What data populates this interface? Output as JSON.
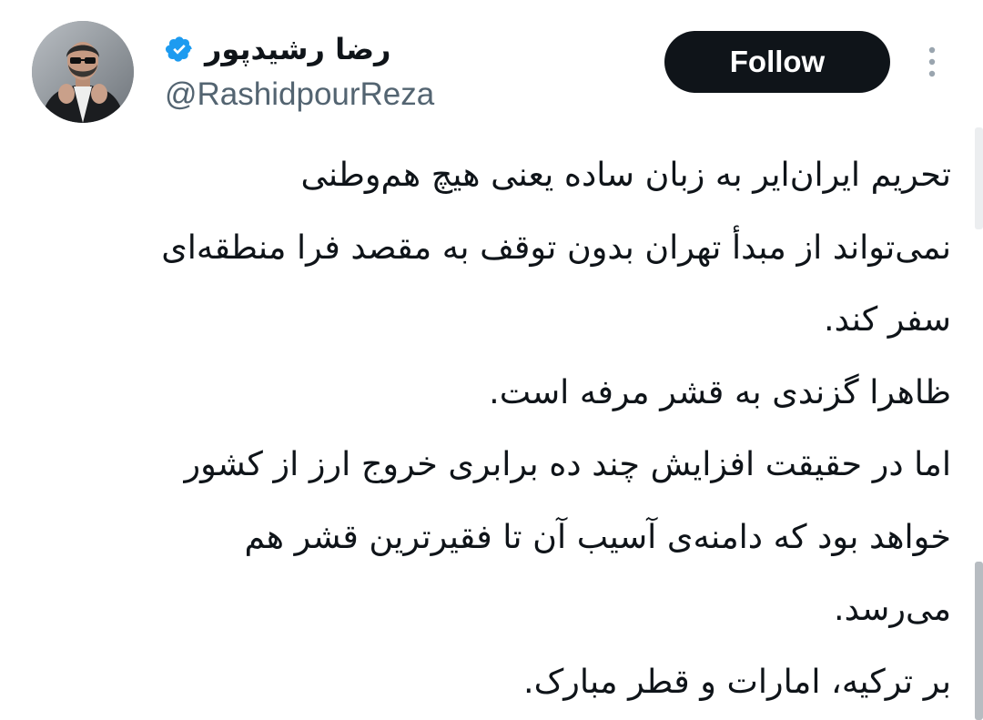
{
  "author": {
    "display_name": "رضا رشیدپور",
    "handle": "@RashidpourReza",
    "verified_color": "#1d9bf0",
    "verified_icon": "verified-badge-icon"
  },
  "actions": {
    "follow_label": "Follow",
    "more_icon": "more-vertical-icon"
  },
  "tweet": {
    "lines": [
      "تحریم ایران‌ایر به زبان ساده یعنی هیچ هم‌وطنی",
      "نمی‌تواند از مبدأ تهران بدون توقف به مقصد فرا منطقه‌ای",
      "سفر کند.",
      "ظاهرا گزندی به قشر مرفه است.",
      "اما در حقیقت افزایش چند ده برابری خروج ارز از کشور",
      "خواهد بود که دامنه‌ی آسیب آن تا فقیرترین قشر هم",
      "می‌رسد.",
      "بر ترکیه، امارات و قطر مبارک."
    ]
  },
  "colors": {
    "text_primary": "#0f1419",
    "text_secondary": "#536471",
    "button_bg": "#0f1419",
    "button_text": "#ffffff"
  }
}
